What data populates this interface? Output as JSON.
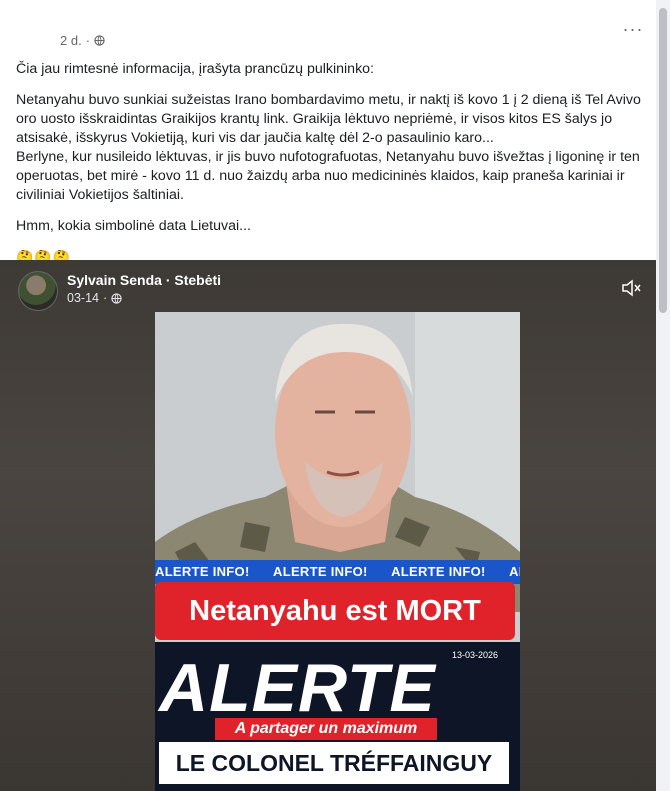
{
  "post": {
    "time": "2 d.",
    "time_sep": "·",
    "more_label": "···",
    "paragraphs": [
      "Čia jau rimtesnė informacija, įrašyta prancūzų pulkininko:",
      "Netanyahu buvo sunkiai sužeistas Irano bombardavimo metu, ir naktį iš kovo 1 į 2 dieną iš Tel Avivo oro uosto išskraidintas Graikijos krantų link. Graikija lėktuvo nepriėmė, ir visos kitos ES šalys jo atsisakė, išskyrus Vokietiją, kuri vis dar jaučia kaltę dėl 2-o pasaulinio karo...\nBerlyne, kur nusileido lėktuvas, ir jis buvo nufotografuotas, Netanyahu buvo išvežtas į ligoninę ir ten operuotas, bet mirė - kovo 11 d. nuo žaizdų arba nuo medicininės klaidos, kaip praneša kariniai ir civiliniai Vokietijos šaltiniai.",
      "Hmm, kokia simbolinė data Lietuvai..."
    ],
    "emojis": "🤔🤔🤔"
  },
  "shared": {
    "author": "Sylvain Senda",
    "follow": "Stebėti",
    "sep": "·",
    "date": "03-14",
    "video": {
      "ticker": [
        "ALERTE INFO!",
        "ALERTE INFO!",
        "ALERTE INFO!",
        "ALERTE INFO!"
      ],
      "headline": "Netanyahu est MORT",
      "alert_date": "13-03-2026",
      "alert_big": "ALERTE",
      "share_text": "A partager un maximum",
      "colonel": "LE COLONEL TRÉFFAINGUY"
    }
  },
  "colors": {
    "accent_red": "#e0232b",
    "ticker_blue": "#1a56c9",
    "dark_navy": "#0d1526"
  }
}
